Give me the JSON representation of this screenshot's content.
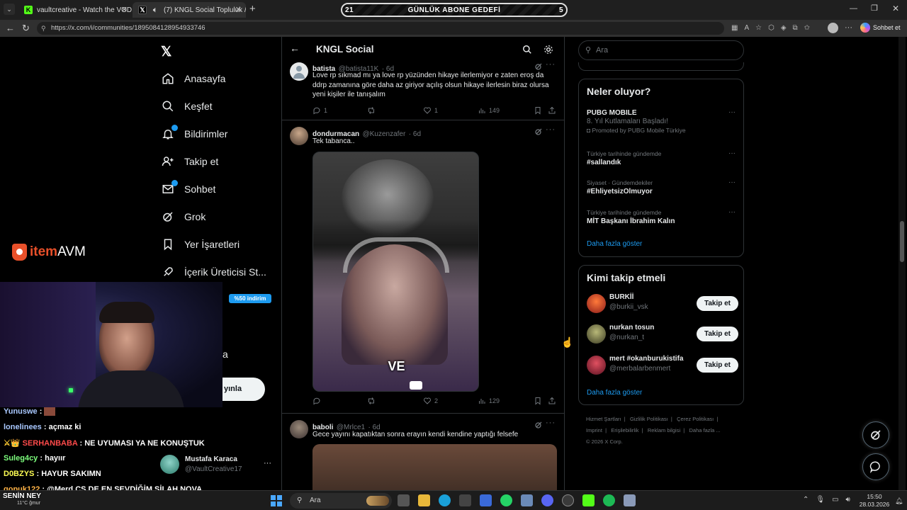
{
  "browser": {
    "tabs": [
      {
        "title": "vaultcreative - Watch the VOD on"
      },
      {
        "title": "(7) KNGL Social Topluluk / X"
      }
    ],
    "url": "https://x.com/i/communities/1895084128954933746",
    "chat_button": "Sohbet et"
  },
  "goal": {
    "label": "GÜNLÜK ABONE GEDEFİ",
    "current": "21",
    "target": "5"
  },
  "sidebar": {
    "items": [
      {
        "label": "Anasayfa"
      },
      {
        "label": "Keşfet"
      },
      {
        "label": "Bildirimler"
      },
      {
        "label": "Takip et"
      },
      {
        "label": "Sohbet"
      },
      {
        "label": "Grok"
      },
      {
        "label": "Yer İşaretleri"
      },
      {
        "label": "İçerik Üreticisi St..."
      }
    ],
    "discount": "%50 indirim",
    "partial_a": "a",
    "post_button_partial": "yınla",
    "account": {
      "name": "Mustafa Karaca",
      "handle": "@VaultCreative17"
    }
  },
  "sponsor": {
    "logo_text_1": "item",
    "logo_text_2": "AVM"
  },
  "community": {
    "title": "KNGL Social"
  },
  "posts": [
    {
      "name": "batista",
      "handle": "@batista11K",
      "time": "· 6d",
      "text": "Love rp sıkmad mı ya love rp yüzünden hikaye ilerlemiyor e zaten eroş da ddrp zamanına göre daha az giriyor açılış olsun hikaye ilerlesin biraz olursa yeni kişiler ile tanışalım",
      "replies": "1",
      "reposts": "",
      "likes": "1",
      "views": "149"
    },
    {
      "name": "dondurmacan",
      "handle": "@Kuzenzafer",
      "time": "· 6d",
      "text": "Tek tabanca..",
      "video_caption": "VE",
      "replies": "",
      "reposts": "",
      "likes": "2",
      "views": "129"
    },
    {
      "name": "baboli",
      "handle": "@Mrlce1",
      "time": "· 6d",
      "text": "Gece yayını kapatıktan sonra erayın kendi kendine yaptığı felsefe"
    }
  ],
  "search": {
    "placeholder": "Ara"
  },
  "trends": {
    "title": "Neler oluyor?",
    "items": [
      {
        "meta": "",
        "name": "PUBG MOBILE",
        "sub": "8. Yıl Kutlamaları Başladı!",
        "promo": "Promoted by PUBG Mobile Türkiye"
      },
      {
        "meta": "Türkiye tarihinde gündemde",
        "name": "#sallandık"
      },
      {
        "meta": "Siyaset · Gündemdekiler",
        "name": "#EhliyetsizOlmuyor"
      },
      {
        "meta": "Türkiye tarihinde gündemde",
        "name": "MİT Başkanı İbrahim Kalın"
      }
    ],
    "show_more": "Daha fazla göster"
  },
  "who_to_follow": {
    "title": "Kimi takip etmeli",
    "users": [
      {
        "name": "BURKİİ",
        "handle": "@burkii_vsk",
        "button": "Takip et",
        "color": "#c0392b"
      },
      {
        "name": "nurkan tosun",
        "handle": "@nurkan_t",
        "button": "Takip et",
        "color": "#7a7a4a"
      },
      {
        "name": "mert #okanburukistifa",
        "handle": "@merbalarbenmert",
        "button": "Takip et",
        "color": "#a02030"
      }
    ],
    "show_more": "Daha fazla göster"
  },
  "footer": {
    "links": [
      "Hizmet Şartları",
      "Gizlilik Politikası",
      "Çerez Politikası",
      "Imprint",
      "Erişilebilirlik",
      "Reklam bilgisi",
      "Daha fazla ..."
    ],
    "copyright": "© 2026 X Corp."
  },
  "chat": [
    {
      "user": "Yunuswe",
      "msg": "",
      "color": "#a9c8ff"
    },
    {
      "user": "lonelinees",
      "msg": "açmaz ki",
      "color": "#a9c8ff"
    },
    {
      "user": "SERHANBABA",
      "msg": "NE UYUMASI YA NE KONUŞTUK",
      "color": "#ff4a4a"
    },
    {
      "user": "Suleg4cy",
      "msg": "hayıır",
      "color": "#7dff7d"
    },
    {
      "user": "D0BZYS",
      "msg": "HAYUR SAKIMN",
      "color": "#ffff55"
    },
    {
      "user": "qopuk122",
      "msg": "@Merd CS DE EN SEVDİĞİM SİLAH NOVA",
      "color": "#ffb347"
    },
    {
      "user": "SENİN NEY",
      "msg": "",
      "color": "#ffffff"
    }
  ],
  "taskbar": {
    "search": "Ara",
    "weather": "11°C",
    "weather_sub": "ğmur",
    "time": "15:50",
    "date": "28.03.2026"
  }
}
